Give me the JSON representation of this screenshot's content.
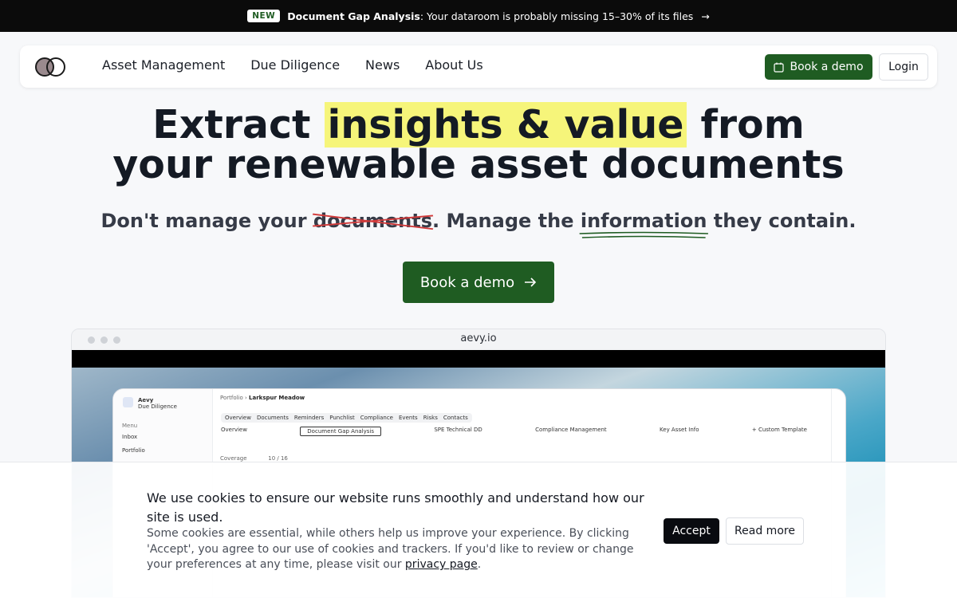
{
  "announcement": {
    "badge": "NEW",
    "title": "Document Gap Analysis",
    "text": ": Your dataroom is probably missing 15–30% of its files",
    "arrow": "→"
  },
  "nav": {
    "links": [
      "Asset Management",
      "Due Diligence",
      "News",
      "About Us"
    ],
    "demo_label": "Book a demo",
    "login_label": "Login"
  },
  "hero": {
    "title_pre": "Extract ",
    "title_highlight": "insights & value",
    "title_post": " from",
    "title_line2": "your renewable asset documents",
    "sub_pre": "Don't manage your ",
    "sub_strike": "documents",
    "sub_mid": ". Manage the ",
    "sub_under": "information",
    "sub_post": " they contain.",
    "cta_label": "Book a demo",
    "cta_icon": "arrow-right-icon"
  },
  "browser": {
    "url": "aevy.io",
    "app": {
      "brand": "Aevy",
      "brand_sub": "Due Diligence",
      "menu_label": "Menu",
      "menu_items": [
        "Inbox",
        "Portfolio"
      ],
      "crumb_root": "Portfolio",
      "crumb_current": "Larkspur Meadow",
      "tabs": [
        "Overview",
        "Documents",
        "Reminders",
        "Punchlist",
        "Compliance",
        "Events",
        "Risks",
        "Contacts"
      ],
      "subtabs": [
        "Overview",
        "Document Gap Analysis",
        "SPE Technical DD",
        "Compliance Management",
        "Key Asset Info",
        "+ Custom Template"
      ],
      "coverage_label": "Coverage",
      "coverage_value": "10 / 16"
    }
  },
  "cookie": {
    "title": "We use cookies to ensure our website runs smoothly and understand how our site is used.",
    "body": "Some cookies are essential, while others help us improve your experience. By clicking 'Accept', you agree to our use of cookies and trackers. If you'd like to review or change your preferences at any time, please visit our ",
    "link": "privacy page",
    "body_end": ".",
    "accept_label": "Accept",
    "read_more_label": "Read more"
  },
  "colors": {
    "brand_green": "#1f5c22",
    "highlight_yellow": "#f6f57a",
    "strike_red": "#d23a3a"
  }
}
